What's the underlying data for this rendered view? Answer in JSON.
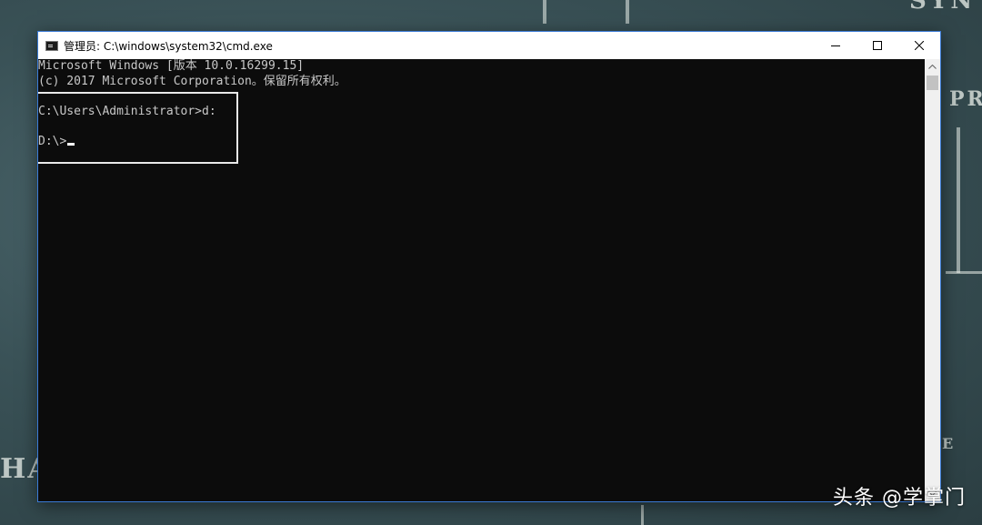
{
  "window": {
    "title": "管理员: C:\\windows\\system32\\cmd.exe"
  },
  "console": {
    "lines": [
      "Microsoft Windows [版本 10.0.16299.15]",
      "(c) 2017 Microsoft Corporation。保留所有权利。",
      "",
      "C:\\Users\\Administrator>d:",
      "",
      "D:\\>"
    ]
  },
  "background": {
    "text_top_right": "SYN",
    "text_right": "PR",
    "text_left": "HA",
    "text_right_small": "E"
  },
  "watermark": "头条 @学掌门"
}
